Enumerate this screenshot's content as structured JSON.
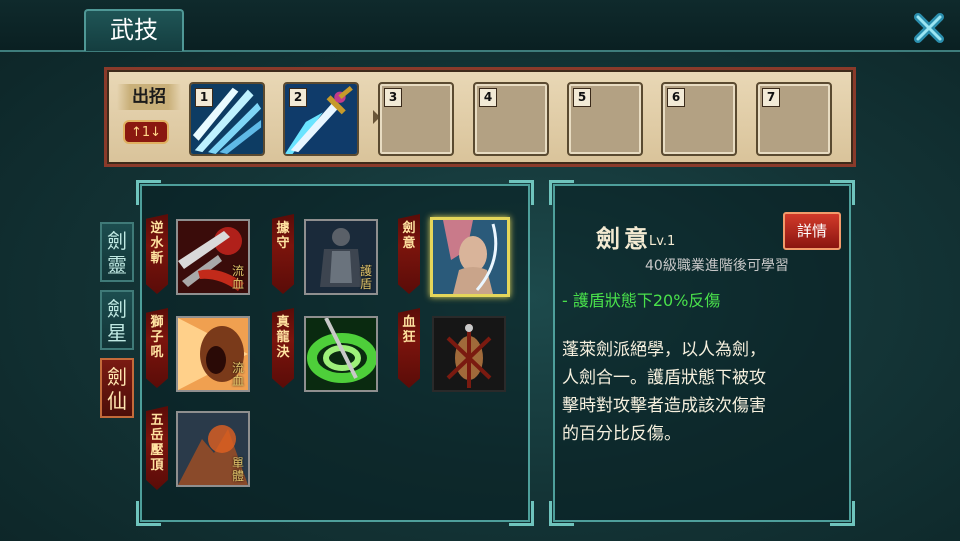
{
  "window": {
    "title": "武技"
  },
  "skill_bar": {
    "label": "出招",
    "round_badge": "↑1↓",
    "slots": [
      {
        "num": "1",
        "icon": "ice-blades-icon"
      },
      {
        "num": "2",
        "icon": "magic-sword-icon"
      },
      {
        "num": "3",
        "icon": ""
      },
      {
        "num": "4",
        "icon": ""
      },
      {
        "num": "5",
        "icon": ""
      },
      {
        "num": "6",
        "icon": ""
      },
      {
        "num": "7",
        "icon": ""
      }
    ]
  },
  "class_tabs": [
    {
      "label": "劍靈",
      "active": false
    },
    {
      "label": "劍星",
      "active": false
    },
    {
      "label": "劍仙",
      "active": true
    }
  ],
  "skills": [
    {
      "name": "逆水斬",
      "tag": "流血"
    },
    {
      "name": "據守",
      "tag": "護盾"
    },
    {
      "name": "劍意",
      "tag": ""
    },
    {
      "name": "獅子吼",
      "tag": "流血"
    },
    {
      "name": "真龍決",
      "tag": ""
    },
    {
      "name": "血狂",
      "tag": ""
    },
    {
      "name": "五岳壓頂",
      "tag": "單體"
    }
  ],
  "detail": {
    "title": "劍意",
    "level": "Lv.1",
    "requirement": "40級職業進階後可學習",
    "effect": "- 護盾狀態下20%反傷",
    "description_lines": [
      "蓬萊劍派絕學，以人為劍，",
      "人劍合一。護盾狀態下被攻",
      "擊時對攻擊者造成該次傷害",
      "的百分比反傷。"
    ],
    "details_button": "詳情"
  },
  "colors": {
    "accent_teal": "#4e9f9b",
    "banner_red": "#7b140d",
    "effect_green": "#49e04b",
    "selected_gold": "#e4d65a"
  }
}
